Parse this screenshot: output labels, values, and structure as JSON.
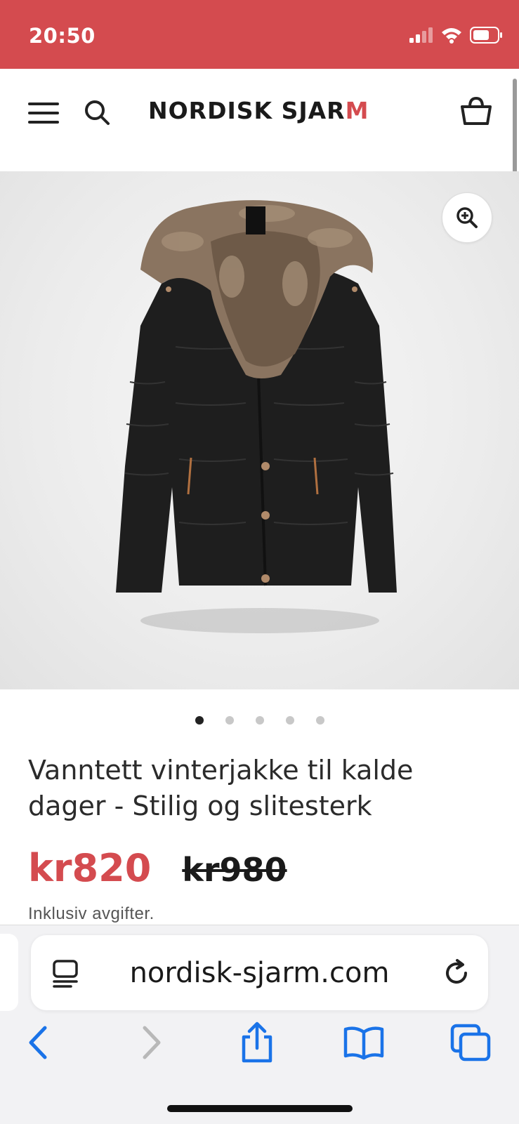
{
  "status": {
    "time": "20:50",
    "icons": [
      "cellular-signal-icon",
      "wifi-icon",
      "battery-icon"
    ]
  },
  "header": {
    "logo_main": "NORDISK SJAR",
    "logo_accent_letter": "M",
    "icons": [
      "menu-icon",
      "search-icon",
      "cart-icon"
    ]
  },
  "gallery": {
    "image_alt": "black winter jacket with fur hood",
    "dots_total": 5,
    "active_dot": 1
  },
  "product": {
    "title": "Vanntett vinterjakke til kalde dager - Stilig og slitesterk",
    "price": "kr820",
    "compare_price": "kr980",
    "tax_note": "Inklusiv avgifter."
  },
  "browser": {
    "url": "nordisk-sjarm.com",
    "toolbar": [
      "back-icon",
      "forward-icon",
      "share-icon",
      "bookmarks-icon",
      "tabs-icon"
    ]
  },
  "colors": {
    "brand": "#d44b4f",
    "browser_blue": "#1a73e8"
  }
}
